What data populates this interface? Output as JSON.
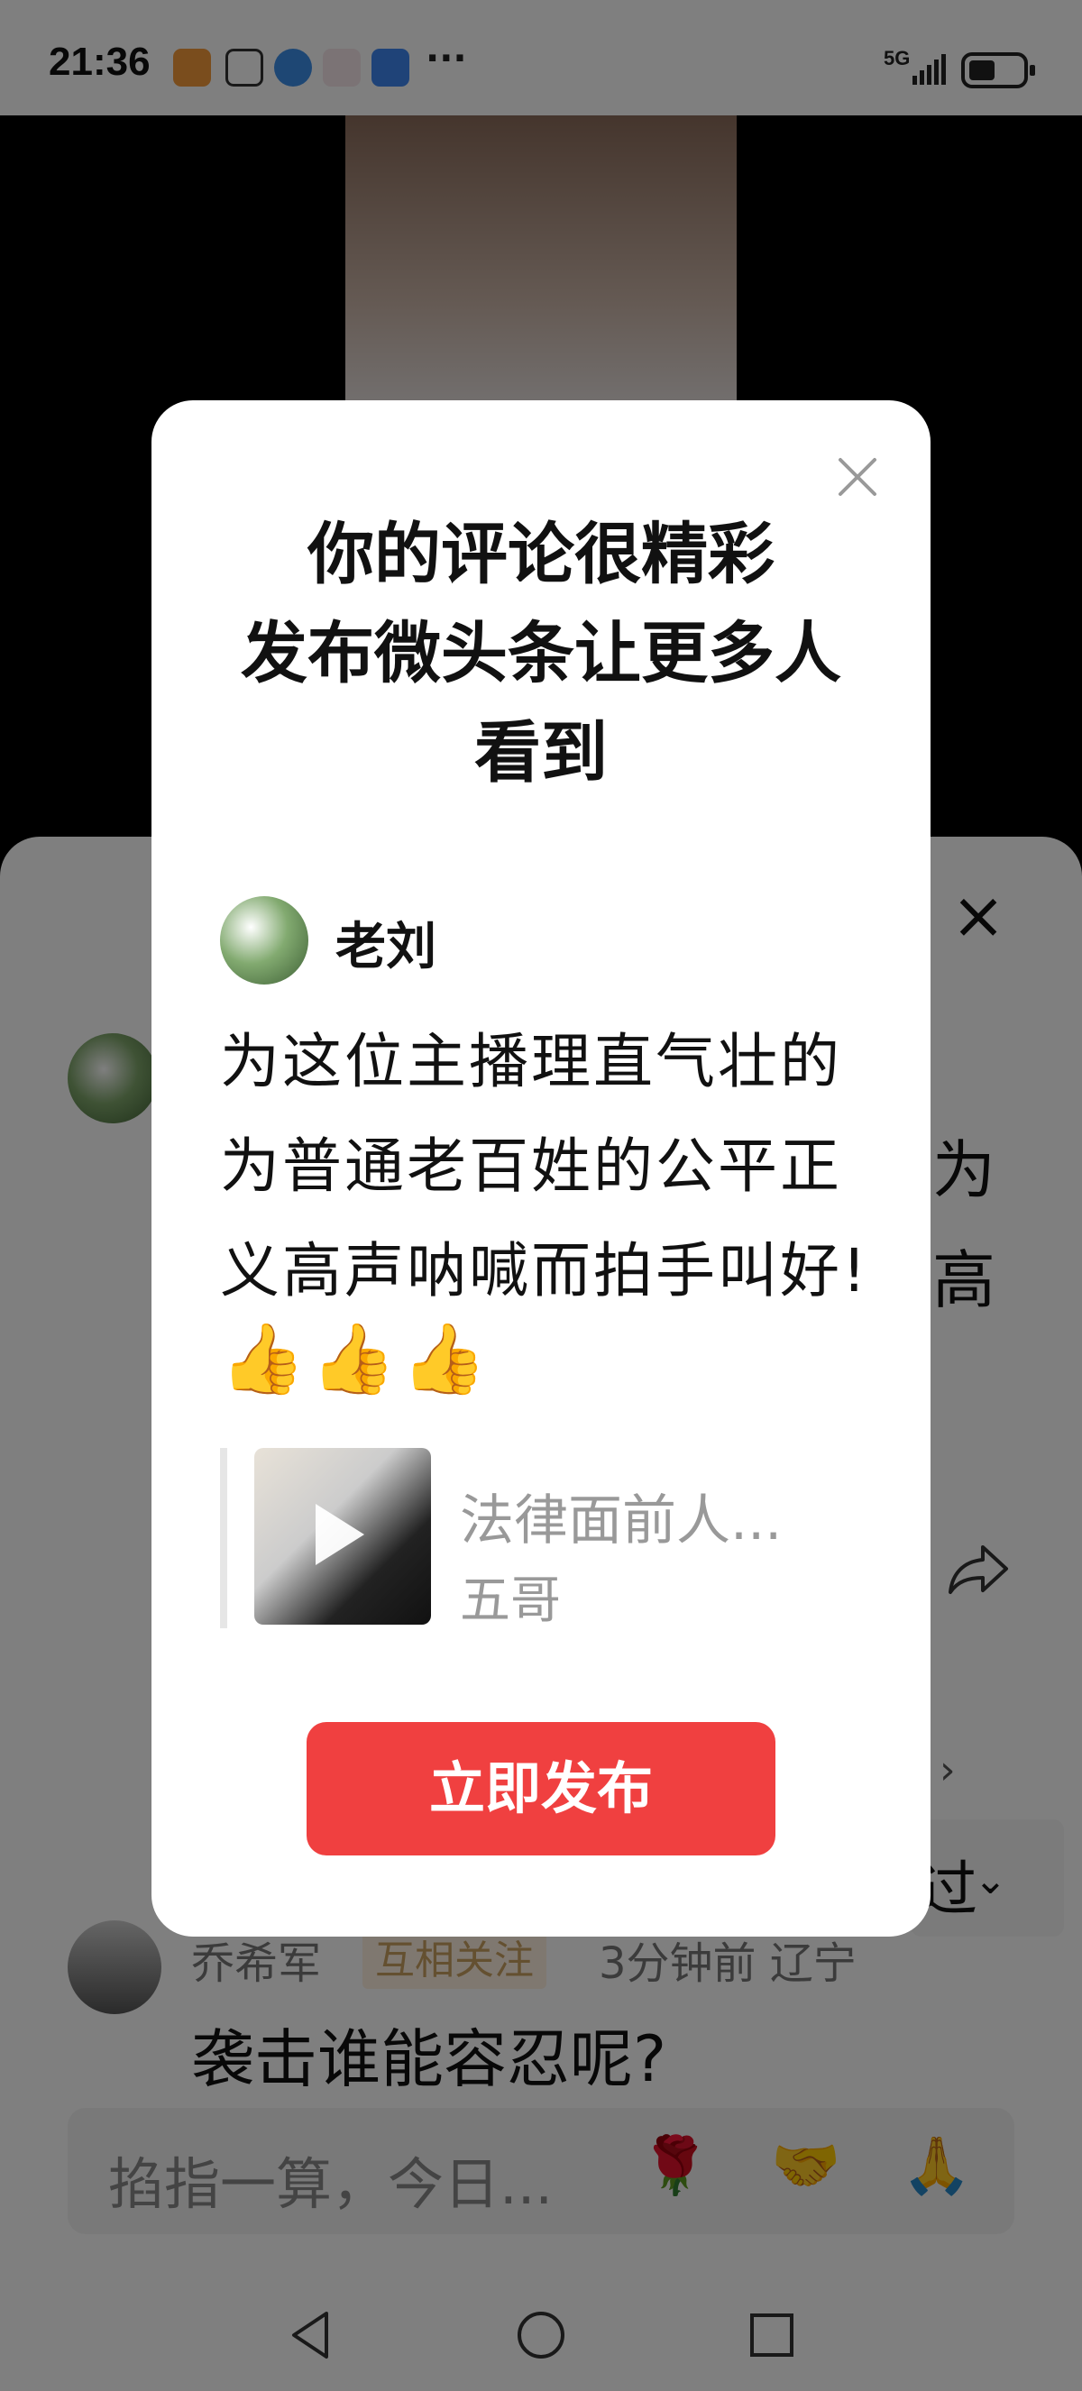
{
  "status_bar": {
    "time": "21:36",
    "network": "5G",
    "more": "···"
  },
  "comment_sheet": {
    "close_icon": "close-icon",
    "bg_line1_end": "为",
    "bg_line2_end": "高",
    "comment2": {
      "user": "乔希军",
      "tag": "互相关注",
      "meta": "3分钟前  辽宁",
      "text": "袭击谁能容忍呢?"
    },
    "chip_text": "过",
    "input_placeholder": "掐指一算，今日...",
    "emojis": [
      "🌹",
      "🤝",
      "🙏"
    ]
  },
  "modal": {
    "title_line1": "你的评论很精彩",
    "title_line2": "发布微头条让更多人",
    "title_line3": "看到",
    "author": "老刘",
    "comment": "为这位主播理直气壮的为普通老百姓的公平正义高声呐喊而拍手叫好!",
    "thumbs": "👍👍👍",
    "quote_title": "法律面前人...",
    "quote_author": "五哥",
    "publish_button": "立即发布"
  },
  "colors": {
    "accent": "#f04040",
    "overlay": "rgba(0,0,0,0.5)"
  }
}
